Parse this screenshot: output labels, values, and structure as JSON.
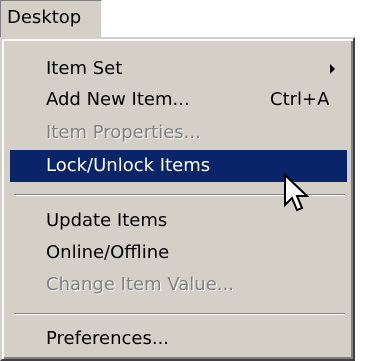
{
  "menubar": {
    "desktop_label": "Desktop"
  },
  "menu": {
    "items": [
      {
        "label": "Item Set",
        "has_submenu": true
      },
      {
        "label": "Add New Item...",
        "shortcut": "Ctrl+A"
      },
      {
        "label": "Item Properties...",
        "disabled": true
      },
      {
        "label": "Lock/Unlock Items",
        "highlighted": true
      },
      {
        "label": "Update Items"
      },
      {
        "label": "Online/Offline"
      },
      {
        "label": "Change Item Value...",
        "disabled": true
      },
      {
        "label": "Preferences..."
      }
    ]
  },
  "colors": {
    "menu_background": "#d4d0c8",
    "highlight": "#0a246a",
    "disabled_text": "#808080"
  },
  "icons": {
    "submenu": "triangle-right-icon",
    "cursor": "mouse-pointer-icon"
  }
}
